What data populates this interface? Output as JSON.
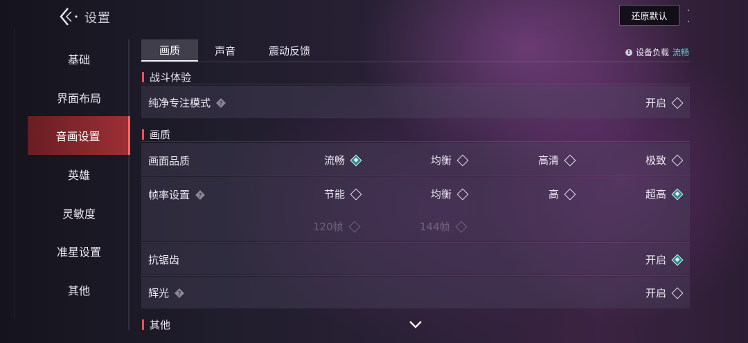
{
  "header": {
    "title": "设置",
    "reset_label": "还原默认"
  },
  "sidebar": {
    "items": [
      {
        "label": "基础",
        "active": false
      },
      {
        "label": "界面布局",
        "active": false
      },
      {
        "label": "音画设置",
        "active": true
      },
      {
        "label": "英雄",
        "active": false
      },
      {
        "label": "灵敏度",
        "active": false
      },
      {
        "label": "准星设置",
        "active": false
      },
      {
        "label": "其他",
        "active": false
      }
    ]
  },
  "tabs": [
    {
      "label": "画质",
      "active": true
    },
    {
      "label": "声音",
      "active": false
    },
    {
      "label": "震动反馈",
      "active": false
    }
  ],
  "device_load": {
    "label": "设备负载",
    "value": "流畅",
    "value_color": "#4fd2d0"
  },
  "sections": {
    "battle": {
      "title": "战斗体验",
      "pure_focus": {
        "label": "纯净专注模式",
        "option": "开启",
        "checked": false
      }
    },
    "quality": {
      "title": "画质",
      "picture_quality": {
        "label": "画面品质",
        "options": [
          {
            "label": "流畅",
            "checked": true
          },
          {
            "label": "均衡",
            "checked": false
          },
          {
            "label": "高清",
            "checked": false
          },
          {
            "label": "极致",
            "checked": false
          }
        ]
      },
      "frame_rate": {
        "label": "帧率设置",
        "options": [
          {
            "label": "节能",
            "checked": false
          },
          {
            "label": "均衡",
            "checked": false
          },
          {
            "label": "高",
            "checked": false
          },
          {
            "label": "超高",
            "checked": true
          }
        ],
        "disabled_options": [
          {
            "label": "120帧"
          },
          {
            "label": "144帧"
          }
        ]
      },
      "anti_aliasing": {
        "label": "抗锯齿",
        "option": "开启",
        "checked": true
      },
      "bloom": {
        "label": "辉光",
        "option": "开启",
        "checked": false
      }
    },
    "other": {
      "title": "其他"
    }
  },
  "colors": {
    "accent_red": "#ff4d57",
    "check_teal": "#1c8f8a",
    "active_tab_bg": "rgba(230,228,240,0.18)"
  }
}
